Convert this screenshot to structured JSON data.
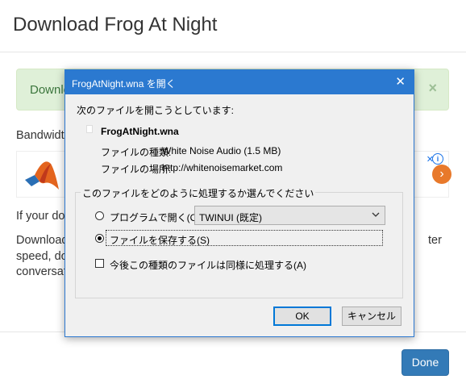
{
  "background": {
    "title": "Download Frog At Night",
    "alert_text": "Downlo",
    "alert_close": "×",
    "bandwidth_text": "Bandwidth",
    "if_text": "If your dov",
    "download_text": "Download",
    "speed_text": "speed, do",
    "conversa_text": "conversat",
    "ter_text": "ter",
    "ad_info": "i",
    "ad_close": "✕",
    "ad_arrow": "›",
    "done_label": "Done"
  },
  "dialog": {
    "title": "FrogAtNight.wna を開く",
    "close": "✕",
    "intro": "次のファイルを開こうとしています:",
    "filename": "FrogAtNight.wna",
    "type_label": "ファイルの種類:",
    "type_value": "White Noise Audio (1.5 MB)",
    "location_label": "ファイルの場所:",
    "location_value": "http://whitenoisemarket.com",
    "group_label": "このファイルをどのように処理するか選んでください",
    "open_with_label": "プログラムで開く(O):",
    "open_with_value": "TWINUI (既定)",
    "save_label": "ファイルを保存する(S)",
    "remember_label": "今後この種類のファイルは同様に処理する(A)",
    "ok_label": "OK",
    "cancel_label": "キャンセル"
  },
  "colors": {
    "dialog_accent": "#2b79d0",
    "done_button": "#337ab7",
    "alert_bg": "#dff0d8"
  },
  "state": {
    "selected_option": "save",
    "remember_checked": false
  }
}
